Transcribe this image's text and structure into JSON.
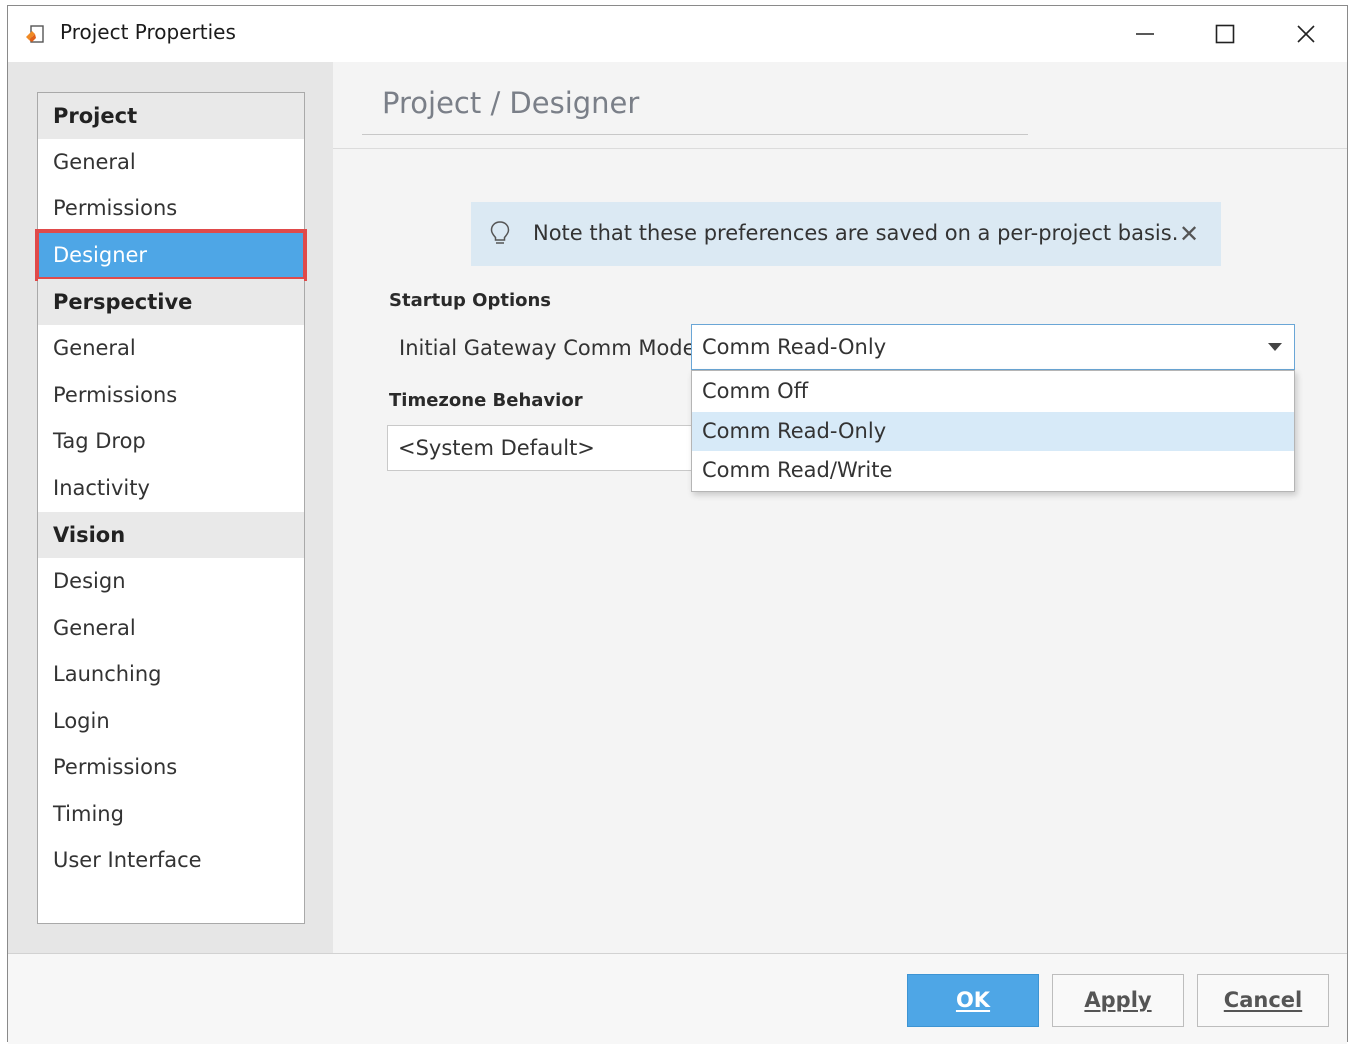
{
  "window": {
    "title": "Project Properties"
  },
  "sidebar": {
    "items": [
      {
        "label": "Project",
        "type": "group"
      },
      {
        "label": "General",
        "type": "item"
      },
      {
        "label": "Permissions",
        "type": "item"
      },
      {
        "label": "Designer",
        "type": "item",
        "selected": true
      },
      {
        "label": "Perspective",
        "type": "group"
      },
      {
        "label": "General",
        "type": "item"
      },
      {
        "label": "Permissions",
        "type": "item"
      },
      {
        "label": "Tag Drop",
        "type": "item"
      },
      {
        "label": "Inactivity",
        "type": "item"
      },
      {
        "label": "Vision",
        "type": "group"
      },
      {
        "label": "Design",
        "type": "item"
      },
      {
        "label": "General",
        "type": "item"
      },
      {
        "label": "Launching",
        "type": "item"
      },
      {
        "label": "Login",
        "type": "item"
      },
      {
        "label": "Permissions",
        "type": "item"
      },
      {
        "label": "Timing",
        "type": "item"
      },
      {
        "label": "User Interface",
        "type": "item"
      }
    ]
  },
  "main": {
    "title": "Project / Designer",
    "note": {
      "text": "Note that these preferences are saved on a per-project basis.",
      "icon": "lightbulb-icon",
      "close_icon": "close-icon"
    },
    "startup": {
      "section": "Startup Options",
      "comm_label": "Initial Gateway Comm Mode",
      "comm_value": "Comm Read-Only",
      "options": [
        "Comm Off",
        "Comm Read-Only",
        "Comm Read/Write"
      ],
      "highlighted_option": "Comm Read-Only"
    },
    "timezone": {
      "section": "Timezone Behavior",
      "value": "<System Default>"
    }
  },
  "footer": {
    "ok_label": "OK",
    "apply_label": "Apply",
    "cancel_label": "Cancel"
  },
  "colors": {
    "accent": "#4ea6e6",
    "selection_outline": "#e04a4a",
    "note_bg": "#dbe9f3",
    "menu_highlight": "#d7eaf8"
  }
}
